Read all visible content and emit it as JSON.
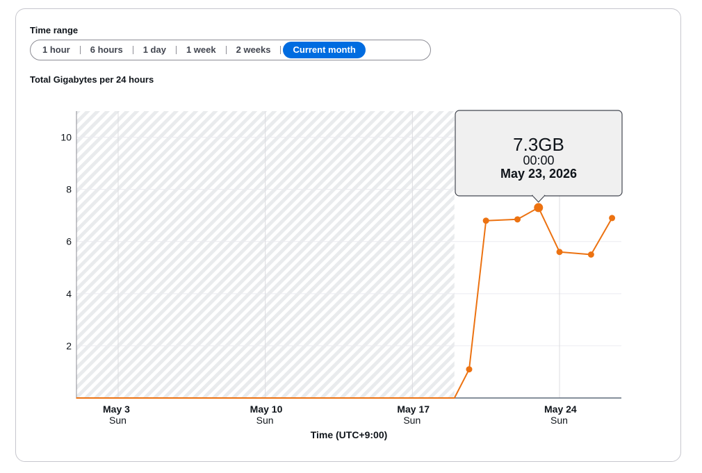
{
  "time_range": {
    "label": "Time range",
    "options": [
      "1 hour",
      "6 hours",
      "1 day",
      "1 week",
      "2 weeks",
      "Current month"
    ],
    "selected": "Current month"
  },
  "colors": {
    "series": "#ec7211",
    "selected_button": "#006ce0"
  },
  "chart_data": {
    "type": "line",
    "title": "Total Gigabytes per 24 hours",
    "xlabel": "Time (UTC+9:00)",
    "ylabel": "",
    "ylim": [
      0,
      11
    ],
    "yticks": [
      2,
      4,
      6,
      8,
      10
    ],
    "xlim": [
      "2026-05-01",
      "2026-05-31"
    ],
    "xticks": [
      {
        "date": "2026-05-03",
        "label": "May 3",
        "sub": "Sun"
      },
      {
        "date": "2026-05-10",
        "label": "May 10",
        "sub": "Sun"
      },
      {
        "date": "2026-05-17",
        "label": "May 17",
        "sub": "Sun"
      },
      {
        "date": "2026-05-24",
        "label": "May 24",
        "sub": "Sun"
      }
    ],
    "no_data_until": "2026-05-19",
    "series": [
      {
        "points": [
          {
            "x": "2026-05-01",
            "y": 0,
            "marker": false
          },
          {
            "x": "2026-05-19",
            "y": 0,
            "marker": false
          },
          {
            "x": "2026-05-19.7",
            "y": 1.1,
            "marker": true
          },
          {
            "x": "2026-05-20.5",
            "y": 6.8,
            "marker": true
          },
          {
            "x": "2026-05-22",
            "y": 6.85,
            "marker": true
          },
          {
            "x": "2026-05-23",
            "y": 7.3,
            "marker": true
          },
          {
            "x": "2026-05-24",
            "y": 5.6,
            "marker": true
          },
          {
            "x": "2026-05-25.5",
            "y": 5.5,
            "marker": true
          },
          {
            "x": "2026-05-26.5",
            "y": 6.9,
            "marker": true
          }
        ]
      }
    ],
    "tooltip": {
      "value": "7.3GB",
      "time": "00:00",
      "date": "May 23, 2026",
      "point_x": "2026-05-23",
      "point_y": 7.3
    }
  }
}
